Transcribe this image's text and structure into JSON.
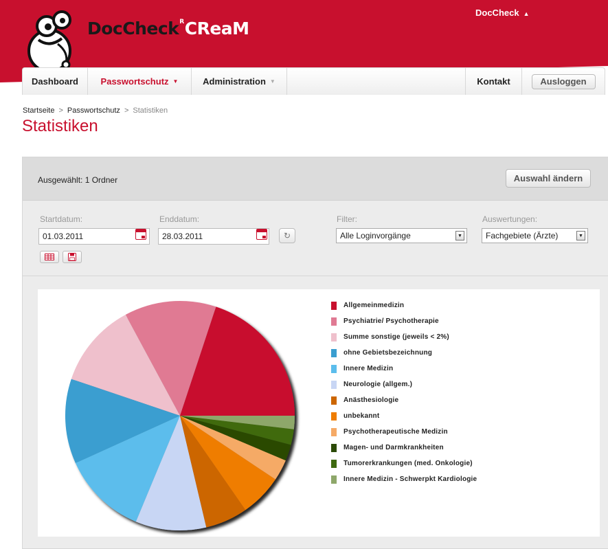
{
  "header": {
    "brand_doc": "DocCheck",
    "brand_cream": "CReaM",
    "brand_reg": "R",
    "account_label": "DocCheck",
    "brand_color": "#c8102e"
  },
  "nav": {
    "items": [
      {
        "label": "Dashboard"
      },
      {
        "label": "Passwortschutz"
      },
      {
        "label": "Administration"
      }
    ],
    "contact_label": "Kontakt",
    "logout_label": "Ausloggen"
  },
  "breadcrumb": {
    "home": "Startseite",
    "sep": ">",
    "section": "Passwortschutz",
    "current": "Statistiken"
  },
  "page_title": "Statistiken",
  "selection": {
    "text": "Ausgewählt: 1 Ordner",
    "change_label": "Auswahl ändern"
  },
  "form": {
    "start_label": "Startdatum:",
    "start_value": "01.03.2011",
    "end_label": "Enddatum:",
    "end_value": "28.03.2011",
    "filter_label": "Filter:",
    "filter_value": "Alle Loginvorgänge",
    "eval_label": "Auswertungen:",
    "eval_value": "Fachgebiete (Ärzte)"
  },
  "chart_data": {
    "type": "pie",
    "legend_position": "right",
    "slices": [
      {
        "label": "Allgemeinmedizin",
        "value": 20,
        "color": "#c8102e"
      },
      {
        "label": "Psychiatrie/ Psychotherapie",
        "value": 13,
        "color": "#e07a93"
      },
      {
        "label": "Summe sonstige (jeweils < 2%)",
        "value": 12,
        "color": "#efc0cc"
      },
      {
        "label": "ohne Gebietsbezeichnung",
        "value": 12,
        "color": "#3a9ed0"
      },
      {
        "label": "Innere Medizin",
        "value": 12,
        "color": "#5bbdec"
      },
      {
        "label": "Neurologie (allgem.)",
        "value": 10,
        "color": "#c8d6f4"
      },
      {
        "label": "Anästhesiologie",
        "value": 6,
        "color": "#cc6600"
      },
      {
        "label": "unbekannt",
        "value": 6,
        "color": "#ef7d00"
      },
      {
        "label": "Psychotherapeutische Medizin",
        "value": 3,
        "color": "#f5aa66"
      },
      {
        "label": "Magen- und Darmkrankheiten",
        "value": 2.3,
        "color": "#2b4a06"
      },
      {
        "label": "Tumorerkrankungen (med. Onkologie)",
        "value": 2.2,
        "color": "#3f6a10"
      },
      {
        "label": "Innere Medizin - Schwerpkt Kardiologie",
        "value": 1.9,
        "color": "#8ea76a"
      }
    ]
  }
}
